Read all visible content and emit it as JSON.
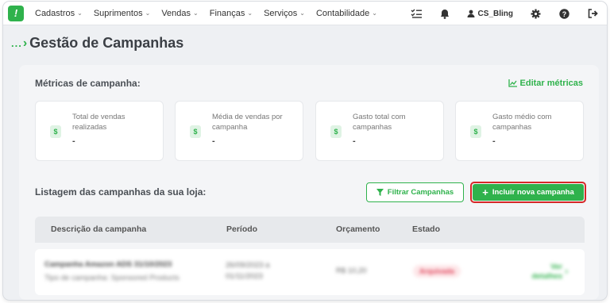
{
  "app": {
    "logo_text": "!",
    "brand_color": "#2fb24c"
  },
  "nav": {
    "items": [
      {
        "label": "Cadastros"
      },
      {
        "label": "Suprimentos"
      },
      {
        "label": "Vendas"
      },
      {
        "label": "Finanças"
      },
      {
        "label": "Serviços"
      },
      {
        "label": "Contabilidade"
      }
    ],
    "user_name": "CS_Bling",
    "icons": [
      "checklist-icon",
      "bell-icon",
      "user-icon",
      "gear-icon",
      "help-icon",
      "logout-icon"
    ]
  },
  "header": {
    "breadcrumb": "...",
    "title": "Gestão de Campanhas"
  },
  "metrics": {
    "section_title": "Métricas de campanha:",
    "edit_label": "Editar métricas",
    "cards": [
      {
        "label": "Total de vendas realizadas",
        "value": "-"
      },
      {
        "label": "Média de vendas por campanha",
        "value": "-"
      },
      {
        "label": "Gasto total com campanhas",
        "value": "-"
      },
      {
        "label": "Gasto médio com campanhas",
        "value": "-"
      }
    ],
    "icon_symbol": "$"
  },
  "listing": {
    "section_title": "Listagem das campanhas da sua loja:",
    "filter_label": "Filtrar Campanhas",
    "new_label": "Incluir nova campanha",
    "columns": [
      "Descrição da campanha",
      "Período",
      "Orçamento",
      "Estado"
    ],
    "rows": [
      {
        "title": "Campanha Amazon ADS 31/10/2023",
        "subtitle": "Tipo de campanha: Sponsored Products",
        "period": "26/09/2023 a 01/11/2023",
        "budget": "R$ 10,20",
        "state": "Arquivada",
        "link": "Ver detalhes"
      }
    ]
  }
}
